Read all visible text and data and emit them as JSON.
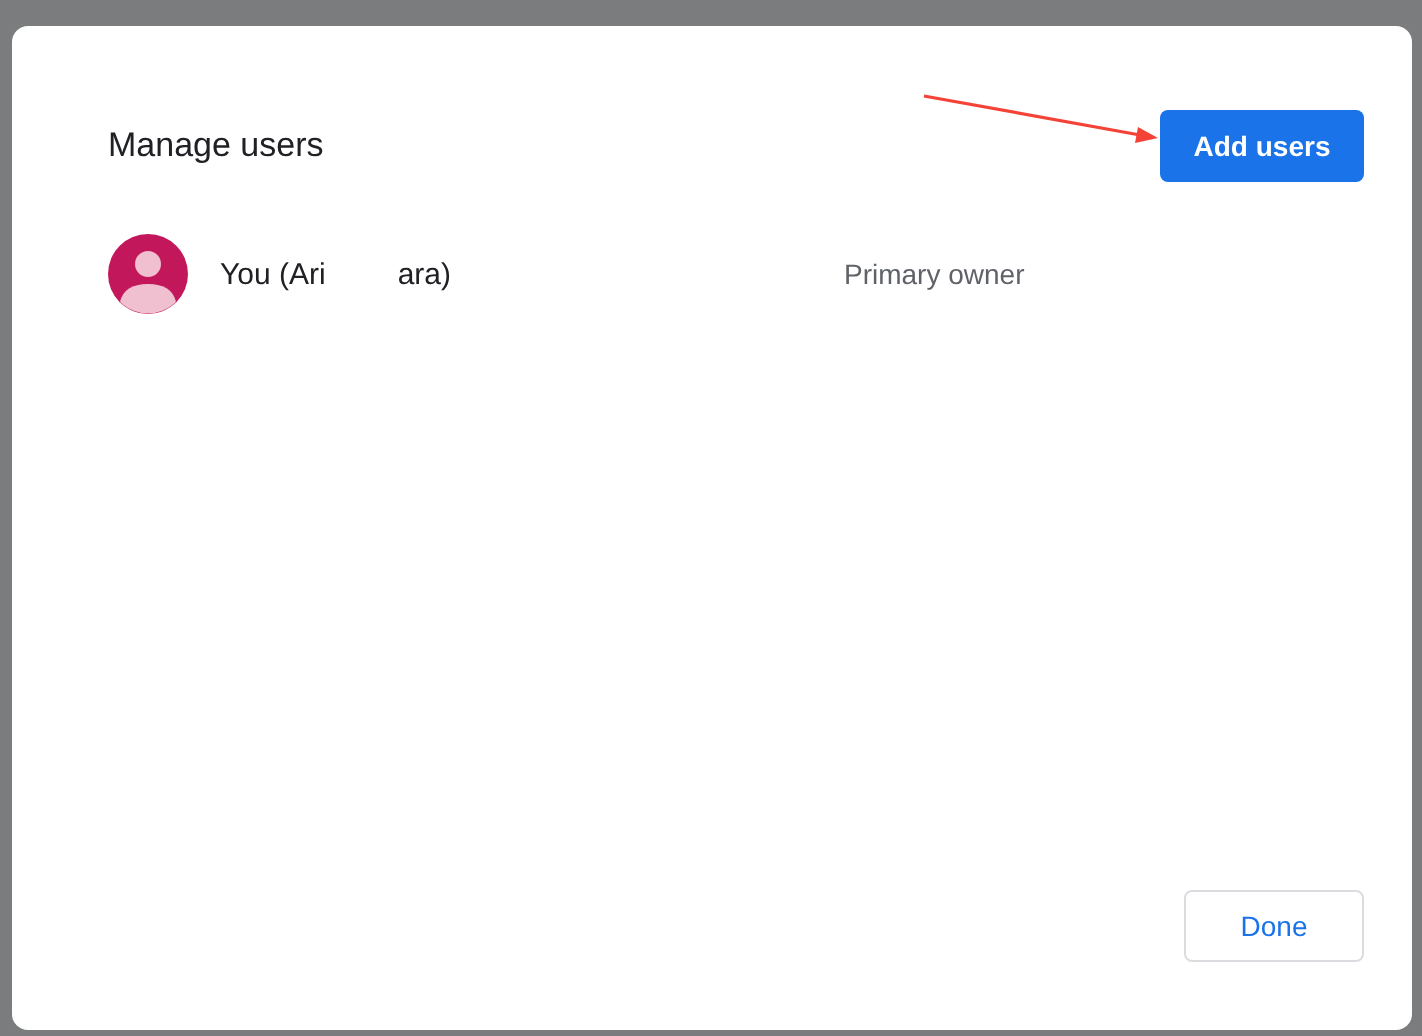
{
  "dialog": {
    "title": "Manage users",
    "primary_button": "Add users",
    "users": [
      {
        "name_parts": [
          "You (Ari",
          "ara)"
        ],
        "role": "Primary owner"
      }
    ],
    "close_button": "Done"
  },
  "annotation": {
    "kind": "arrow"
  }
}
